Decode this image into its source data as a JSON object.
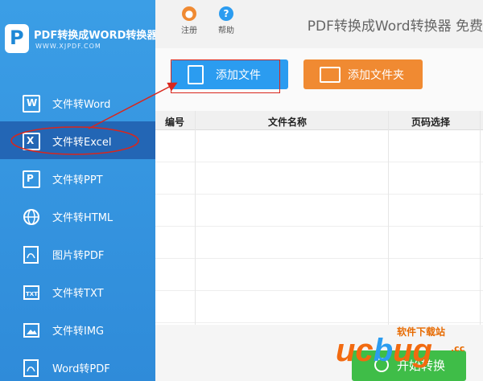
{
  "logo": {
    "title": "PDF转换成WORD转换器",
    "url": "WWW.XJPDF.COM"
  },
  "toolbar": {
    "register_label": "注册",
    "help_label": "帮助",
    "help_glyph": "?",
    "app_title": "PDF转换成Word转换器 免费"
  },
  "sidebar": {
    "items": [
      {
        "label": "文件转Word",
        "icon": "W"
      },
      {
        "label": "文件转Excel",
        "icon": "X",
        "active": true
      },
      {
        "label": "文件转PPT",
        "icon": "P"
      },
      {
        "label": "文件转HTML",
        "icon": "globe"
      },
      {
        "label": "图片转PDF",
        "icon": "pdf"
      },
      {
        "label": "文件转TXT",
        "icon": "TXT"
      },
      {
        "label": "文件转IMG",
        "icon": "image"
      },
      {
        "label": "Word转PDF",
        "icon": "pdf"
      }
    ]
  },
  "actions": {
    "add_file_label": "添加文件",
    "add_folder_label": "添加文件夹"
  },
  "table": {
    "columns": [
      "编号",
      "文件名称",
      "页码选择"
    ],
    "rows": []
  },
  "bottom": {
    "start_label": "开始转换"
  },
  "watermark": {
    "cn": "软件下载站",
    "big": "ucbug",
    "com": ".cc"
  },
  "colors": {
    "sidebar": "#3b9ee6",
    "active": "#2366b5",
    "add_file": "#2b9cf0",
    "add_folder": "#f08a32",
    "start": "#3fbd48",
    "annotation": "#d9261c"
  }
}
